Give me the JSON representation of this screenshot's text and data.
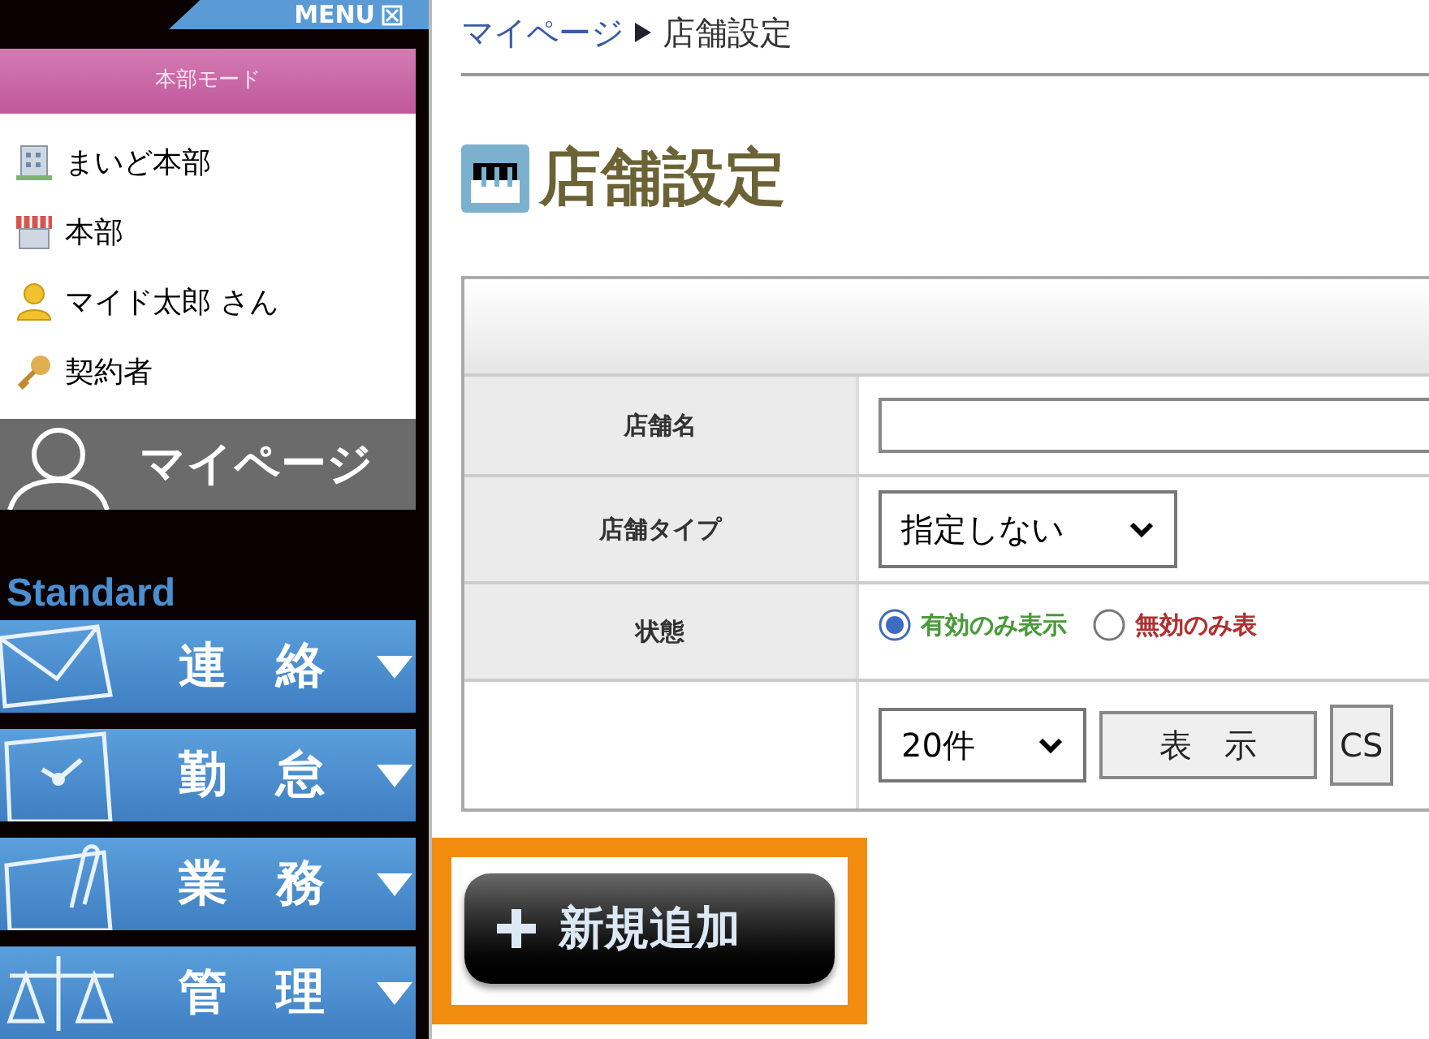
{
  "sidebar": {
    "menu_tab": {
      "label": "MENU"
    },
    "mode_header": "本部モード",
    "user_info": [
      {
        "kind": "company",
        "text": "まいど本部"
      },
      {
        "kind": "store",
        "text": "本部"
      },
      {
        "kind": "user",
        "text": "マイド太郎 さん"
      },
      {
        "kind": "role",
        "text": "契約者"
      }
    ],
    "mypage": "マイページ",
    "section_title": "Standard",
    "menu_items": [
      {
        "kind": "mail",
        "label": "連　絡",
        "expanded": false
      },
      {
        "kind": "clock",
        "label": "勤　怠",
        "expanded": false
      },
      {
        "kind": "clip",
        "label": "業　務",
        "expanded": false
      },
      {
        "kind": "scale",
        "label": "管　理",
        "expanded": false
      }
    ]
  },
  "breadcrumb": [
    {
      "text": "マイページ",
      "link": true
    },
    {
      "text": "店舗設定",
      "link": false
    }
  ],
  "page_title": "店舗設定",
  "search_form": {
    "rows": [
      {
        "kind": "text",
        "label": "店舗名",
        "value": ""
      },
      {
        "kind": "select",
        "label": "店舗タイプ",
        "value": "指定しない"
      },
      {
        "kind": "radio",
        "label": "状態",
        "options": [
          {
            "text": "有効のみ表示",
            "selected": true,
            "color": "#4a9a3a"
          },
          {
            "text": "無効のみ表",
            "selected": false,
            "color": "#b03030"
          }
        ]
      },
      {
        "kind": "actions",
        "label": "",
        "per_page": "20件",
        "buttons": [
          "表　示",
          "CS"
        ]
      }
    ]
  },
  "add_button": {
    "label": "新規追加",
    "highlighted": true
  }
}
